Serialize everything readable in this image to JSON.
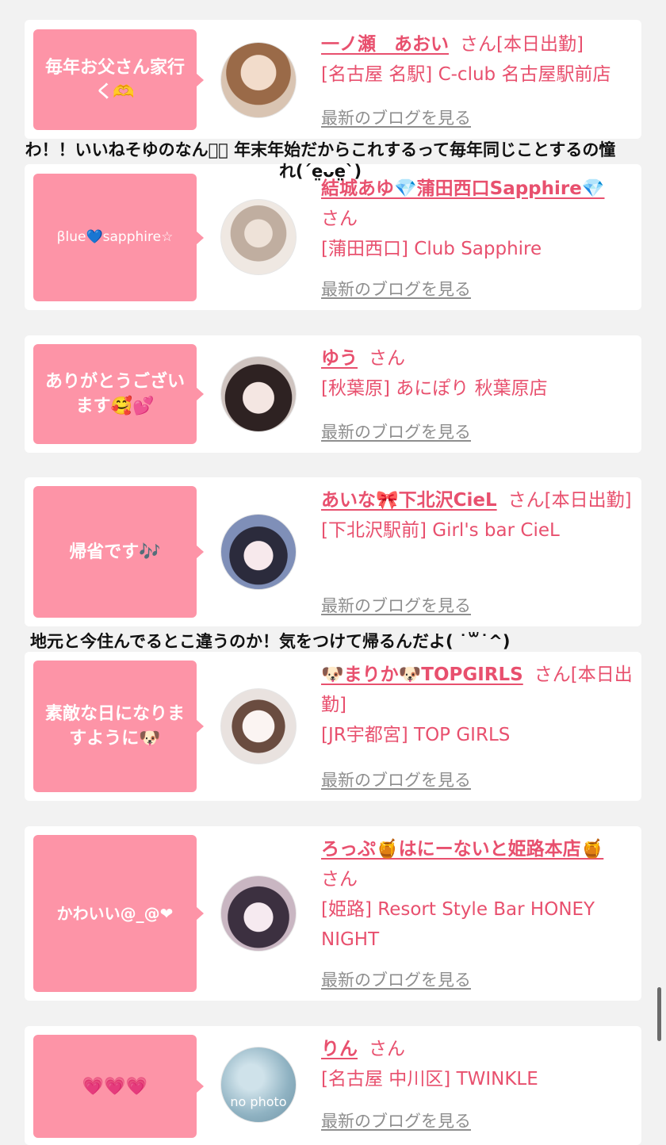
{
  "cards": [
    {
      "bubble": "毎年お父さん家行く🫶",
      "name": "一ノ瀬　あおい",
      "san": "さん[本日出勤]",
      "shop": "[名古屋 名駅] C-club 名古屋駅前店",
      "blog": "最新のブログを見る",
      "avatar_colors": [
        "#e9d2be",
        "#8a5a3a"
      ]
    },
    {
      "bubble": "βlue💙sapphire☆",
      "name": "結城あゆ💎蒲田西口Sapphire💎",
      "san": "さん",
      "shop": "[蒲田西口] Club Sapphire",
      "blog": "最新のブログを見る",
      "avatar_colors": [
        "#d8cbbf",
        "#a99a8e"
      ]
    },
    {
      "bubble": "ありがとうございます🥰💕",
      "name": "ゆう",
      "san": "さん",
      "shop": "[秋葉原] あにぽり 秋葉原店",
      "blog": "最新のブログを見る",
      "avatar_colors": [
        "#e6d6d4",
        "#3a2a2a"
      ]
    },
    {
      "bubble": "帰省です🎶",
      "name": "あいな🎀下北沢CieL",
      "san": "さん[本日出勤]",
      "shop": "[下北沢駅前] Girl's bar CieL",
      "blog": "最新のブログを見る",
      "avatar_colors": [
        "#c9d6ea",
        "#4b5a7a"
      ]
    },
    {
      "bubble": "素敵な日になりますように🐶",
      "name": "🐶まりか🐶TOPGIRLS",
      "san": "さん[本日出勤]",
      "shop": "[JR宇都宮] TOP GIRLS",
      "blog": "最新のブログを見る",
      "avatar_colors": [
        "#efe7e4",
        "#8b6b5e"
      ]
    },
    {
      "bubble": "かわいい@_@❤",
      "name": "ろっぷ🍯はにーないと姫路本店🍯",
      "san": "さん",
      "shop": "[姫路] Resort Style Bar HONEY NIGHT",
      "blog": "最新のブログを見る",
      "avatar_colors": [
        "#d9c6cf",
        "#4a3a44"
      ]
    },
    {
      "bubble": "💗💗💗",
      "name": "りん",
      "san": "さん",
      "shop": "[名古屋 中川区] TWINKLE",
      "blog": "最新のブログを見る",
      "avatar_colors": [
        "#a9c9d6",
        "#7aa0b2"
      ],
      "avatar_text": "no photo"
    }
  ],
  "comments": [
    "わ！！いいねそゆのなんか🏻 年末年始だからこれするって毎年同じことするの憧れ(ˊe̤ᴗe̤ˋ)",
    "地元と今住んでるとこ違うのか！気をつけて帰るんだよ( ˙꒳˙^)"
  ],
  "colors": {
    "accent_pink": "#e8506e",
    "bubble_pink": "#fd94a7",
    "link_gray": "#8e8e8e",
    "background": "#f2f2f2"
  }
}
